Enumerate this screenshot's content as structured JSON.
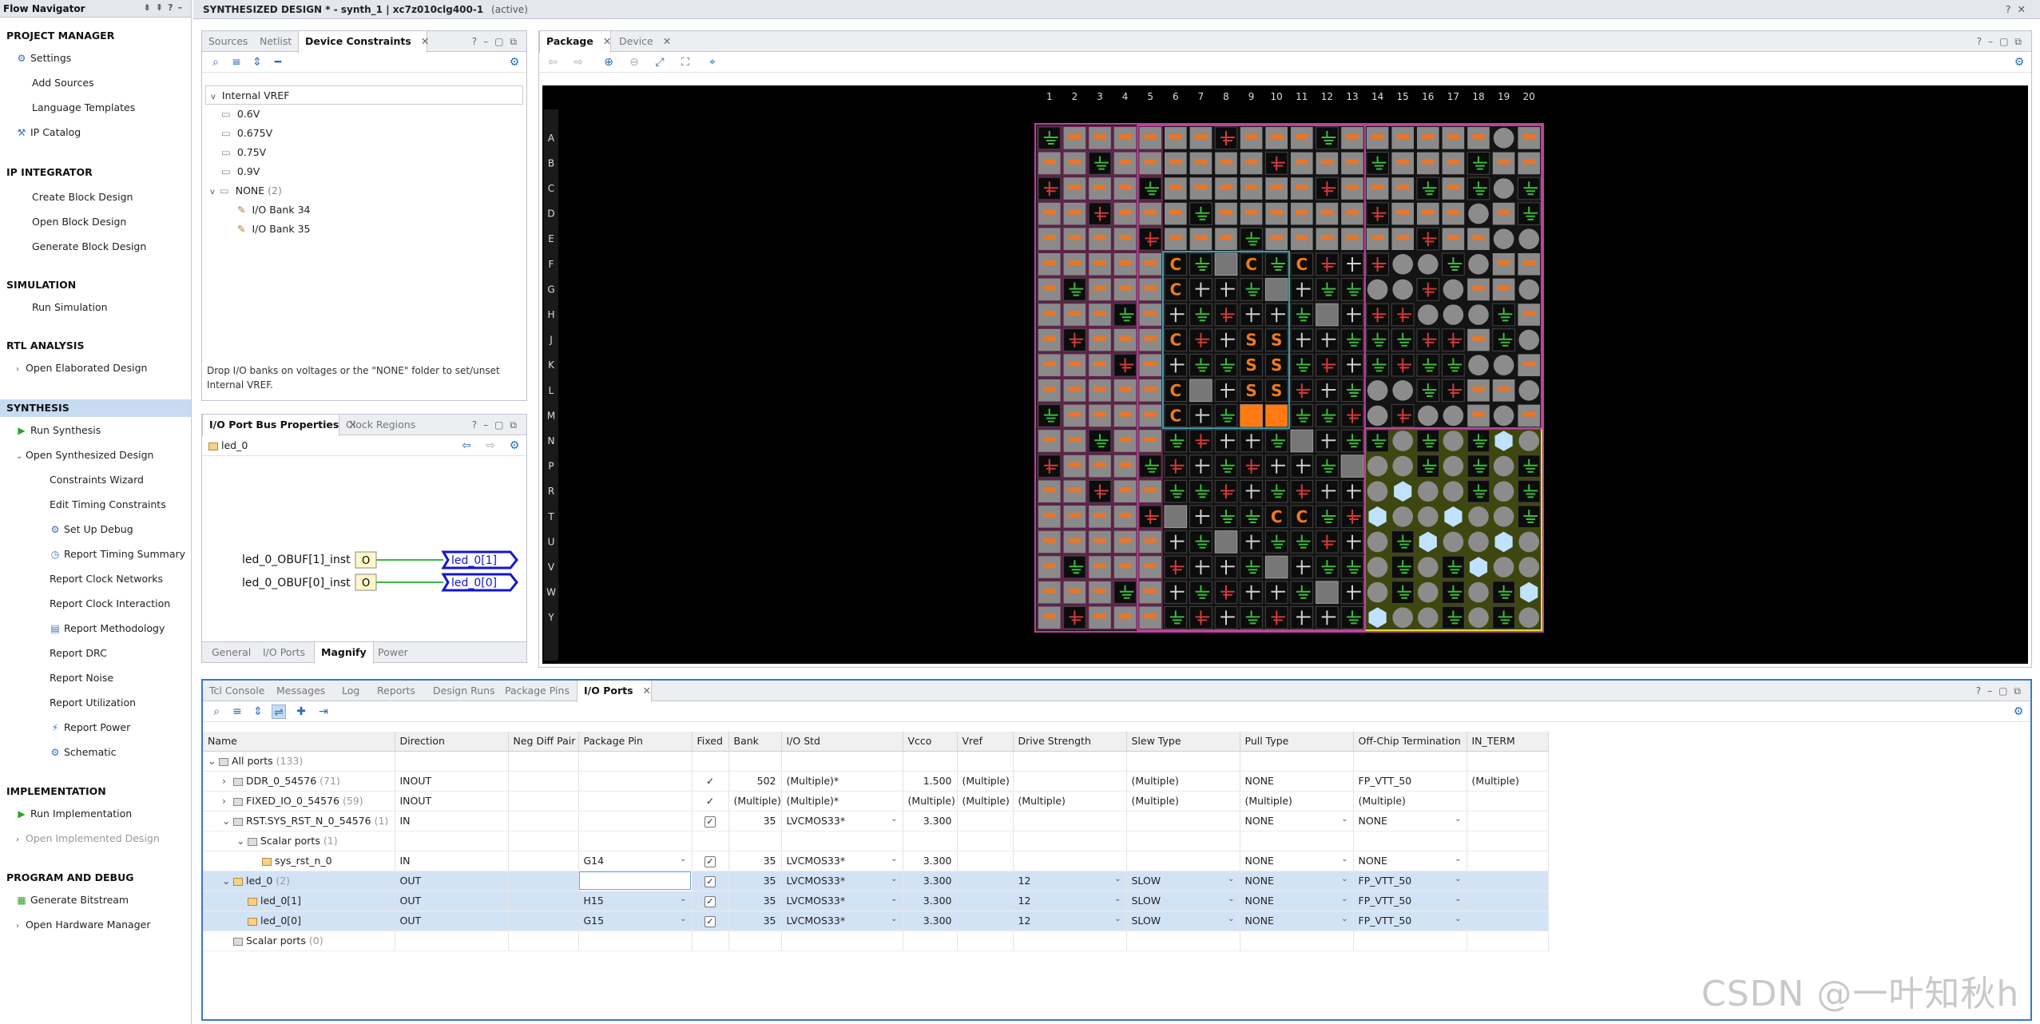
{
  "nav": {
    "title": "Flow Navigator",
    "items": [
      {
        "label": "PROJECT MANAGER",
        "kind": "section"
      },
      {
        "label": "Settings",
        "icon": "gear-icon"
      },
      {
        "label": "Add Sources"
      },
      {
        "label": "Language Templates"
      },
      {
        "label": "IP Catalog",
        "icon": "ip-icon"
      },
      {
        "label": "IP INTEGRATOR",
        "kind": "section"
      },
      {
        "label": "Create Block Design"
      },
      {
        "label": "Open Block Design"
      },
      {
        "label": "Generate Block Design"
      },
      {
        "label": "SIMULATION",
        "kind": "section"
      },
      {
        "label": "Run Simulation"
      },
      {
        "label": "RTL ANALYSIS",
        "kind": "section"
      },
      {
        "label": "Open Elaborated Design"
      },
      {
        "label": "SYNTHESIS",
        "kind": "section"
      },
      {
        "label": "Run Synthesis",
        "icon": "play-icon"
      },
      {
        "label": "Open Synthesized Design"
      },
      {
        "label": "Constraints Wizard"
      },
      {
        "label": "Edit Timing Constraints"
      },
      {
        "label": "Set Up Debug",
        "icon": "debug-icon"
      },
      {
        "label": "Report Timing Summary",
        "icon": "clock-icon"
      },
      {
        "label": "Report Clock Networks"
      },
      {
        "label": "Report Clock Interaction"
      },
      {
        "label": "Report Methodology",
        "icon": "report-icon"
      },
      {
        "label": "Report DRC"
      },
      {
        "label": "Report Noise"
      },
      {
        "label": "Report Utilization"
      },
      {
        "label": "Report Power",
        "icon": "power-icon"
      },
      {
        "label": "Schematic",
        "icon": "schematic-icon"
      },
      {
        "label": "IMPLEMENTATION",
        "kind": "section"
      },
      {
        "label": "Run Implementation",
        "icon": "play-icon"
      },
      {
        "label": "Open Implemented Design"
      },
      {
        "label": "PROGRAM AND DEBUG",
        "kind": "section"
      },
      {
        "label": "Generate Bitstream",
        "icon": "bitstream-icon"
      },
      {
        "label": "Open Hardware Manager"
      }
    ]
  },
  "header": {
    "title": "SYNTHESIZED DESIGN * - synth_1 | xc7z010clg400-1",
    "status": "(active)"
  },
  "sources": {
    "tabs": [
      "Sources",
      "Netlist",
      "Device Constraints"
    ],
    "root": "Internal VREF",
    "vref": [
      "0.6V",
      "0.675V",
      "0.75V",
      "0.9V"
    ],
    "none_label": "NONE",
    "none_count": "(2)",
    "banks": [
      "I/O Bank 34",
      "I/O Bank 35"
    ],
    "hint": "Drop I/O banks on voltages or the \"NONE\" folder to set/unset Internal VREF."
  },
  "busprops": {
    "tabs": [
      "I/O Port Bus Properties",
      "Clock Regions"
    ],
    "name": "led_0",
    "cells": [
      "led_0_OBUF[1]_inst",
      "led_0_OBUF[0]_inst"
    ],
    "pin": "O",
    "ports": [
      "led_0[1]",
      "led_0[0]"
    ],
    "bottom_tabs": [
      "General",
      "I/O Ports",
      "Magnify",
      "Power"
    ]
  },
  "package": {
    "tabs": [
      "Package",
      "Device"
    ],
    "cols": [
      "1",
      "2",
      "3",
      "4",
      "5",
      "6",
      "7",
      "8",
      "9",
      "10",
      "11",
      "12",
      "13",
      "14",
      "15",
      "16",
      "17",
      "18",
      "19",
      "20"
    ],
    "rows": [
      "A",
      "B",
      "C",
      "D",
      "E",
      "F",
      "G",
      "H",
      "J",
      "K",
      "L",
      "M",
      "N",
      "P",
      "R",
      "T",
      "U",
      "V",
      "W",
      "Y"
    ],
    "markers": [
      {
        "r": 5,
        "c": 5,
        "t": "C"
      },
      {
        "r": 5,
        "c": 8,
        "t": "C"
      },
      {
        "r": 5,
        "c": 10,
        "t": "C"
      },
      {
        "r": 6,
        "c": 5,
        "t": "C"
      },
      {
        "r": 8,
        "c": 5,
        "t": "C"
      },
      {
        "r": 10,
        "c": 5,
        "t": "C"
      },
      {
        "r": 11,
        "c": 5,
        "t": "C"
      },
      {
        "r": 15,
        "c": 9,
        "t": "C"
      },
      {
        "r": 15,
        "c": 10,
        "t": "C"
      },
      {
        "r": 8,
        "c": 8,
        "t": "S"
      },
      {
        "r": 8,
        "c": 9,
        "t": "S"
      },
      {
        "r": 9,
        "c": 8,
        "t": "S"
      },
      {
        "r": 9,
        "c": 9,
        "t": "S"
      },
      {
        "r": 10,
        "c": 8,
        "t": "S"
      },
      {
        "r": 10,
        "c": 9,
        "t": "S"
      }
    ]
  },
  "console": {
    "tabs": [
      "Tcl Console",
      "Messages",
      "Log",
      "Reports",
      "Design Runs",
      "Package Pins",
      "I/O Ports"
    ],
    "columns": [
      "Name",
      "Direction",
      "Neg Diff Pair",
      "Package Pin",
      "Fixed",
      "Bank",
      "I/O Std",
      "Vcco",
      "Vref",
      "Drive Strength",
      "Slew Type",
      "Pull Type",
      "Off-Chip Termination",
      "IN_TERM"
    ],
    "rows": [
      {
        "name": "All ports",
        "count": "(133)",
        "depth": 0,
        "exp": "v"
      },
      {
        "name": "DDR_0_54576",
        "count": "(71)",
        "depth": 1,
        "exp": ">",
        "dir": "INOUT",
        "fixed": "✓",
        "bank": "502",
        "std": "(Multiple)*",
        "vcco": "1.500",
        "vref": "(Multiple)",
        "slew": "(Multiple)",
        "pull": "NONE",
        "term": "FP_VTT_50",
        "interm": "(Multiple)"
      },
      {
        "name": "FIXED_IO_0_54576",
        "count": "(59)",
        "depth": 1,
        "exp": ">",
        "dir": "INOUT",
        "fixed": "✓",
        "bank": "(Multiple)",
        "std": "(Multiple)*",
        "vcco": "(Multiple)",
        "vref": "(Multiple)",
        "drive": "(Multiple)",
        "slew": "(Multiple)",
        "pull": "(Multiple)",
        "term": "(Multiple)"
      },
      {
        "name": "RST.SYS_RST_N_0_54576",
        "count": "(1)",
        "depth": 1,
        "exp": "v",
        "dir": "IN",
        "fixed": "box",
        "bank": "35",
        "std": "LVCMOS33*",
        "vcco": "3.300",
        "pull": "NONE",
        "term": "NONE"
      },
      {
        "name": "Scalar ports",
        "count": "(1)",
        "depth": 2,
        "exp": "v"
      },
      {
        "name": "sys_rst_n_0",
        "depth": 3,
        "port": true,
        "dir": "IN",
        "pin": "G14",
        "fixed": "box",
        "bank": "35",
        "std": "LVCMOS33*",
        "vcco": "3.300",
        "pull": "NONE",
        "term": "NONE"
      },
      {
        "name": "led_0",
        "count": "(2)",
        "depth": 1,
        "exp": "v",
        "sel": true,
        "port": true,
        "dir": "OUT",
        "pin": "",
        "pinedit": true,
        "fixed": "box",
        "bank": "35",
        "std": "LVCMOS33*",
        "vcco": "3.300",
        "drive": "12",
        "slew": "SLOW",
        "pull": "NONE",
        "term": "FP_VTT_50"
      },
      {
        "name": "led_0[1]",
        "depth": 2,
        "sel": true,
        "port": true,
        "dir": "OUT",
        "pin": "H15",
        "fixed": "box",
        "bank": "35",
        "std": "LVCMOS33*",
        "vcco": "3.300",
        "drive": "12",
        "slew": "SLOW",
        "pull": "NONE",
        "term": "FP_VTT_50"
      },
      {
        "name": "led_0[0]",
        "depth": 2,
        "sel": true,
        "port": true,
        "dir": "OUT",
        "pin": "G15",
        "fixed": "box",
        "bank": "35",
        "std": "LVCMOS33*",
        "vcco": "3.300",
        "drive": "12",
        "slew": "SLOW",
        "pull": "NONE",
        "term": "FP_VTT_50"
      },
      {
        "name": "Scalar ports",
        "count": "(0)",
        "depth": 1
      }
    ]
  },
  "watermark": "CSDN @一叶知秋h"
}
